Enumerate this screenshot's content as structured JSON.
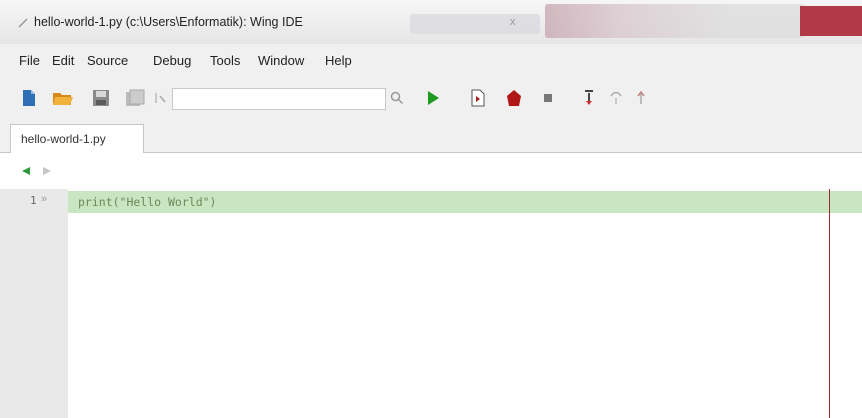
{
  "window": {
    "title": "hello-world-1.py (c:\\Users\\Enformatik): Wing IDE",
    "blurred_tab": "x"
  },
  "menu": [
    "File",
    "Edit",
    "Source",
    "Debug",
    "Tools",
    "Window",
    "Help"
  ],
  "toolbar": {
    "search_value": ""
  },
  "tabs": [
    {
      "label": "hello-world-1.py"
    }
  ],
  "editor": {
    "lines": [
      {
        "number": "1",
        "code": "print(\"Hello World\")"
      }
    ]
  },
  "colors": {
    "current_line": "#c8e6c2",
    "edge_line": "#9a2a30",
    "run_green": "#1e9a1e"
  }
}
